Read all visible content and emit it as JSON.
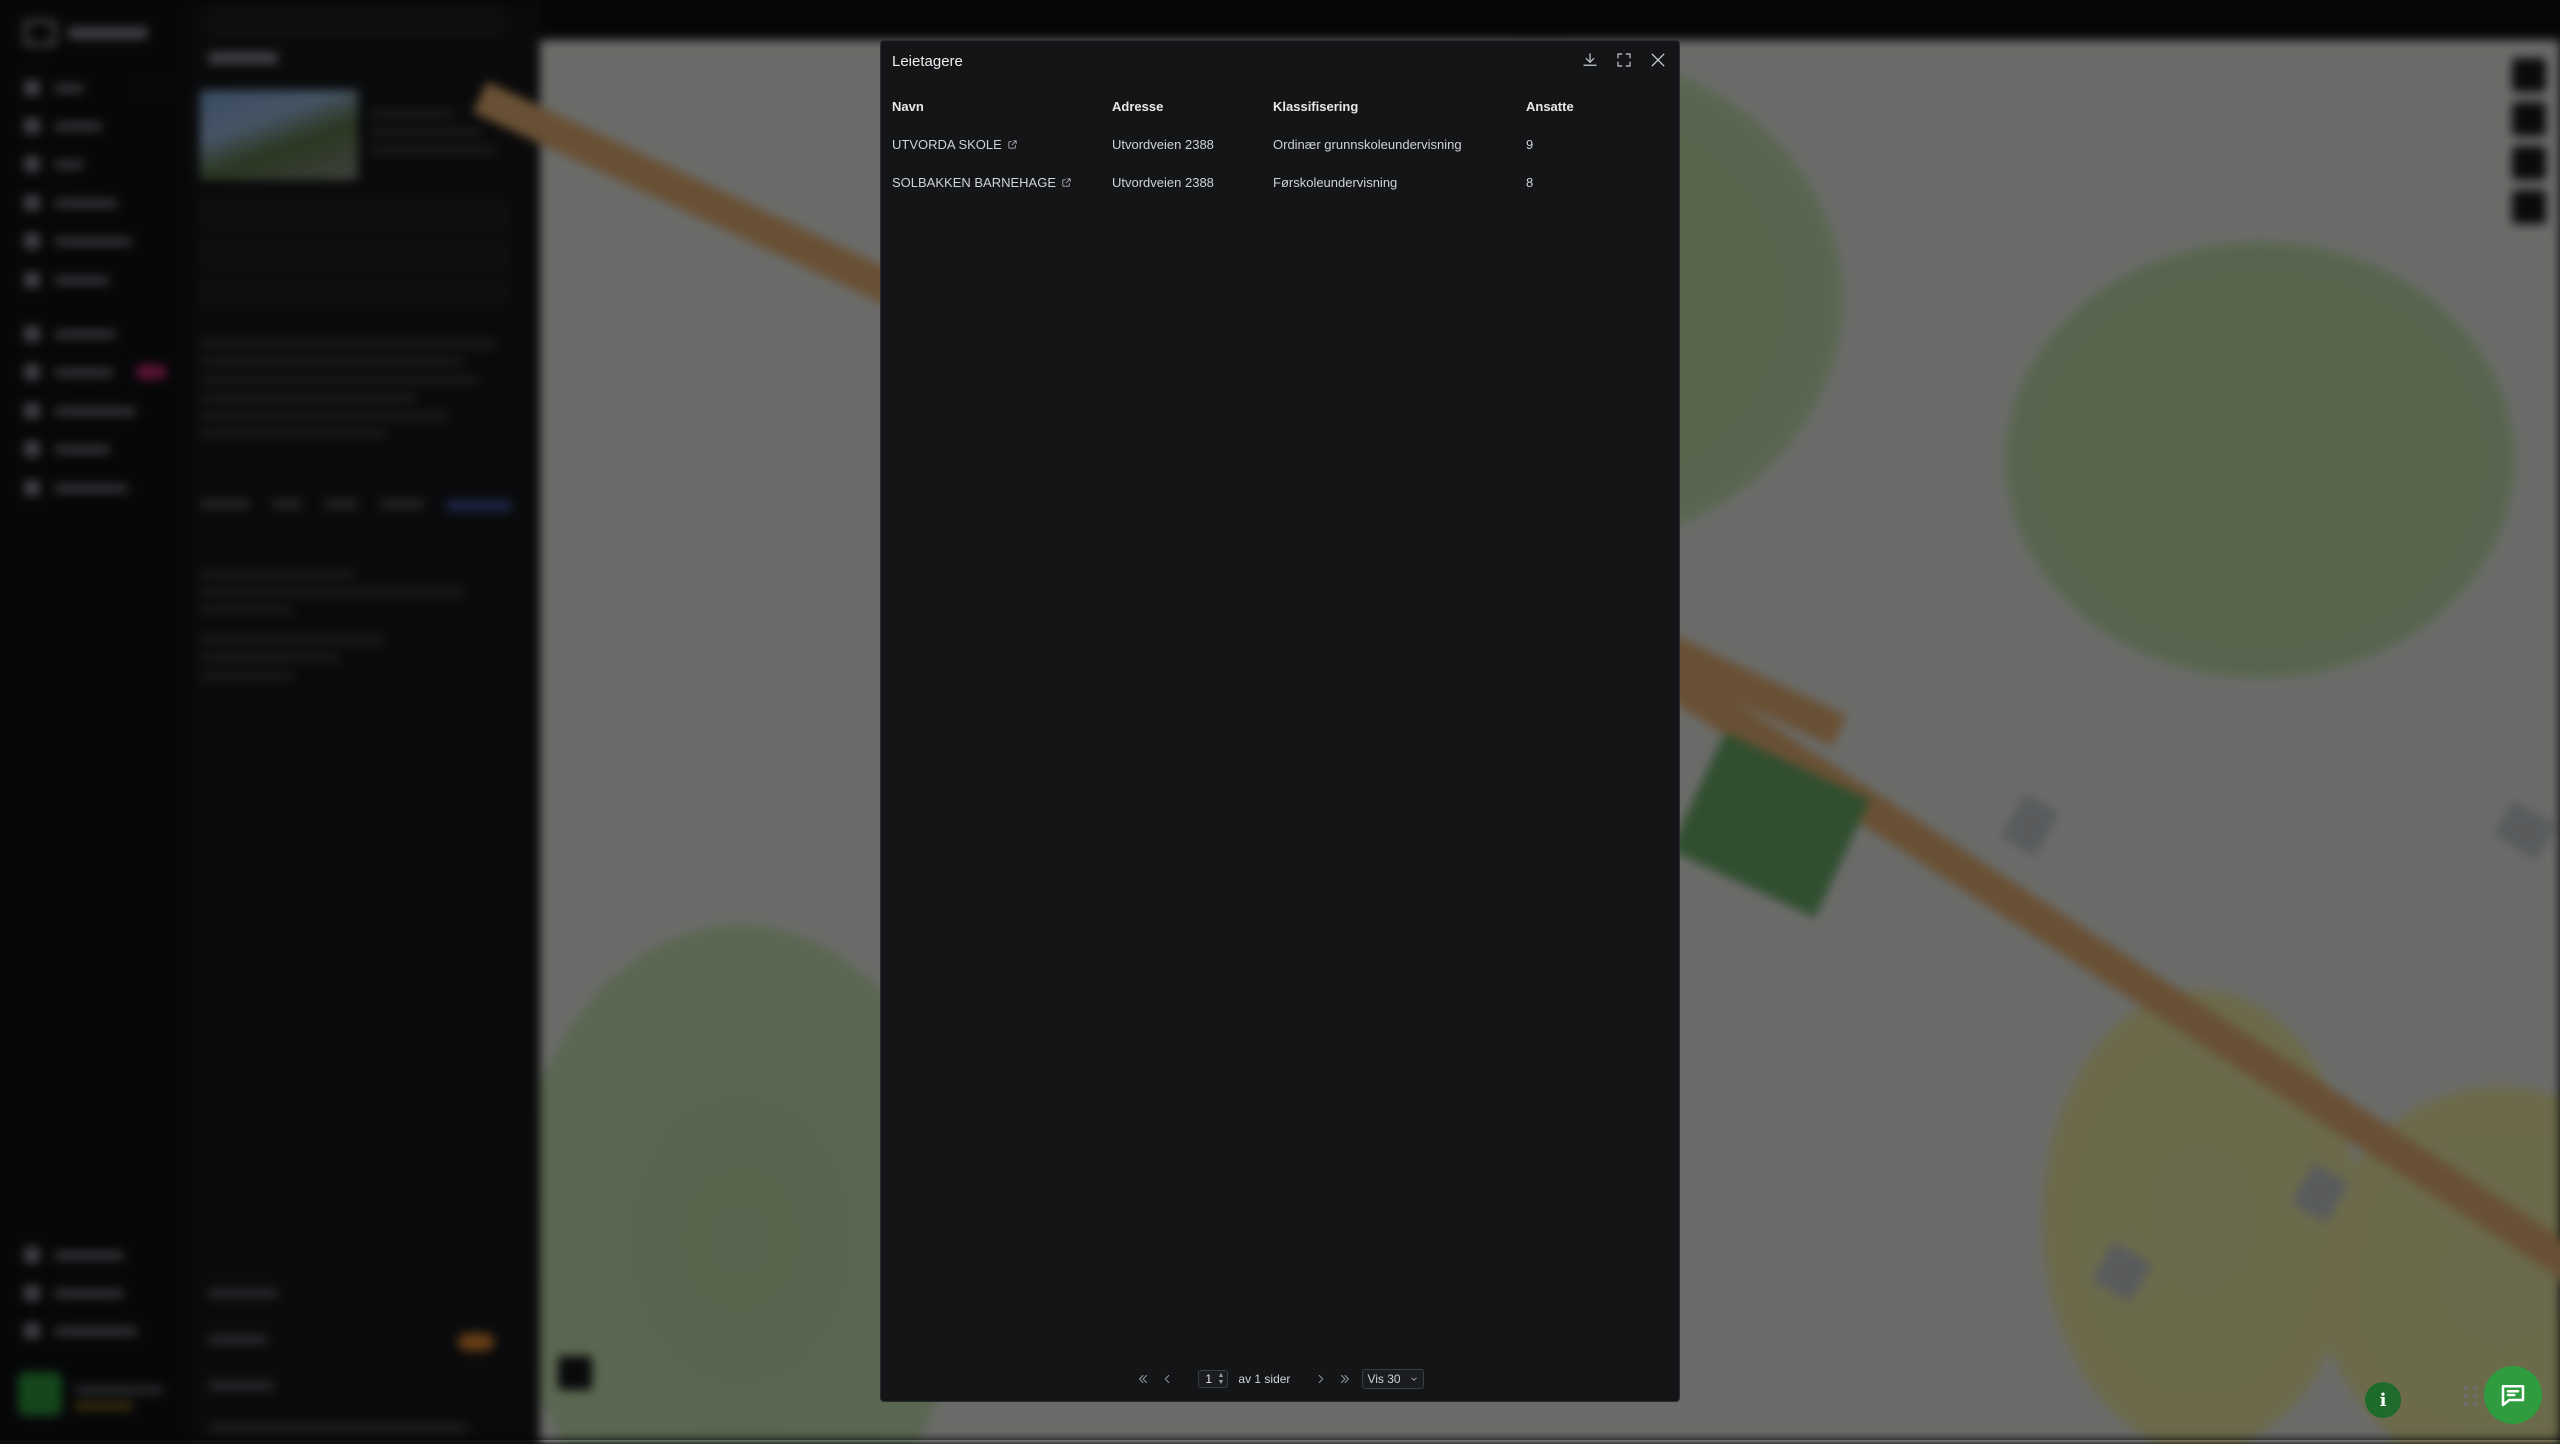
{
  "modal": {
    "title": "Leietagere",
    "download_label": "Last ned",
    "expand_label": "Fullskjerm",
    "close_label": "Lukk",
    "columns": [
      "Navn",
      "Adresse",
      "Klassifisering",
      "Ansatte"
    ],
    "rows": [
      {
        "name": "UTVORDA SKOLE",
        "address": "Utvordveien 2388",
        "classification": "Ordinær grunnskoleundervisning",
        "employees": "9"
      },
      {
        "name": "SOLBAKKEN BARNEHAGE",
        "address": "Utvordveien 2388",
        "classification": "Førskoleundervisning",
        "employees": "8"
      }
    ],
    "pagination": {
      "current_page": "1",
      "of_pages_text": "av 1 sider",
      "page_size_label": "Vis 30"
    }
  },
  "icons": {
    "download": "download-icon",
    "expand": "expand-icon",
    "close": "close-icon",
    "external_link": "external-link-icon",
    "first_page": "double-chevron-left-icon",
    "prev_page": "chevron-left-icon",
    "next_page": "chevron-right-icon",
    "last_page": "double-chevron-right-icon",
    "chat": "chat-icon",
    "info": "info-icon"
  },
  "colors": {
    "modal_bg": "#141517",
    "accent_green": "#2f9c3f"
  }
}
